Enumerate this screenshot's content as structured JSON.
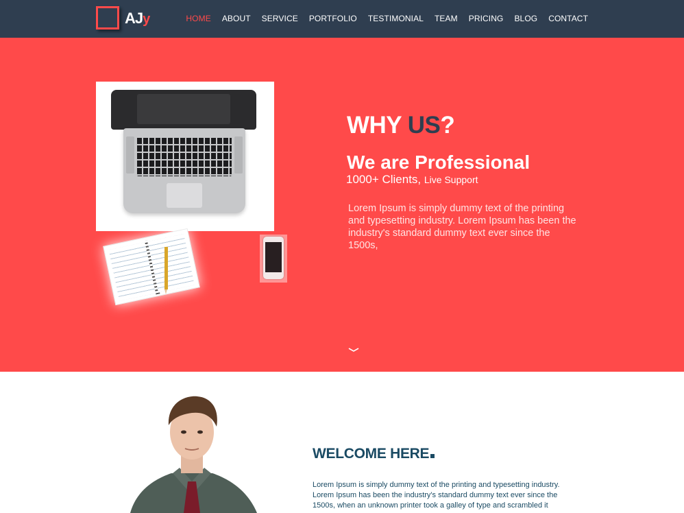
{
  "logo": {
    "text_main": "AJ",
    "text_accent": "y"
  },
  "nav": {
    "items": [
      {
        "label": "HOME",
        "active": true
      },
      {
        "label": "ABOUT",
        "active": false
      },
      {
        "label": "SERVICE",
        "active": false
      },
      {
        "label": "PORTFOLIO",
        "active": false
      },
      {
        "label": "TESTIMONIAL",
        "active": false
      },
      {
        "label": "TEAM",
        "active": false
      },
      {
        "label": "PRICING",
        "active": false
      },
      {
        "label": "BLOG",
        "active": false
      },
      {
        "label": "CONTACT",
        "active": false
      }
    ]
  },
  "hero": {
    "title_main": "WHY ",
    "title_accent": "US",
    "title_end": "?",
    "subtitle": "We are Professional",
    "clients": "1000+ Clients, ",
    "support": "Live Support",
    "body": "Lorem Ipsum is simply dummy text of the printing and typesetting industry. Lorem Ipsum has been the industry's standard dummy text ever since the 1500s,"
  },
  "welcome": {
    "title": "WELCOME HERE",
    "body": "Lorem Ipsum is simply dummy text of the printing and typesetting industry. Lorem Ipsum has been the industry's standard dummy text ever since the 1500s, when an unknown printer took a galley of type and scrambled it"
  },
  "colors": {
    "navbar": "#2f3e50",
    "accent": "#ff4a4a",
    "heading_dark": "#1a4a63"
  }
}
